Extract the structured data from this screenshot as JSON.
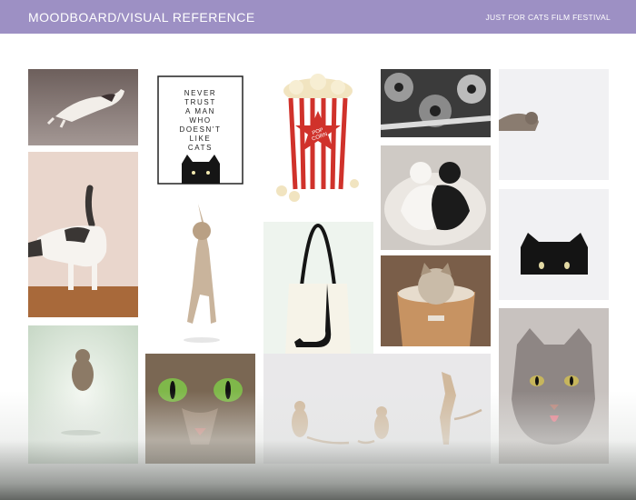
{
  "header": {
    "title": "MOODBOARD/VISUAL REFERENCE",
    "subtitle": "JUST FOR CATS FILM FESTIVAL"
  },
  "poster": {
    "lines": [
      "NEVER",
      "TRUST",
      "A MAN",
      "WHO",
      "DOESN'T",
      "LIKE",
      "CATS"
    ]
  },
  "popcorn": {
    "label": "POP CORN"
  },
  "colors": {
    "header": "#9d90c4",
    "popcorn_red": "#d0322b",
    "eye_green": "#7fb84a"
  }
}
